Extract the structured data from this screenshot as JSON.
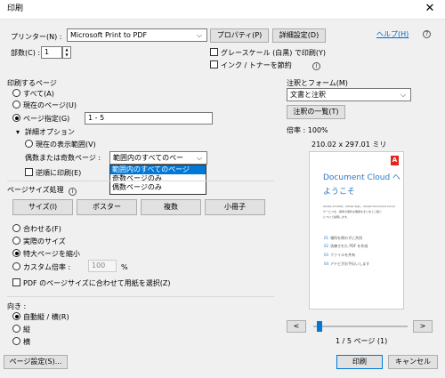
{
  "window": {
    "title": "印刷",
    "close_glyph": "✕"
  },
  "printer": {
    "label": "プリンター(N) :",
    "selected": "Microsoft Print to PDF",
    "properties_button": "プロパティ(P)",
    "advanced_button": "詳細設定(D)",
    "help_link": "ヘルプ(H)",
    "copies_label": "部数(C) :",
    "copies_value": "1",
    "grayscale_label": "グレースケール (白黒) で印刷(Y)",
    "save_ink_label": "インク / トナーを節約"
  },
  "pages_to_print": {
    "heading": "印刷するページ",
    "options": [
      "すべて(A)",
      "現在のページ(U)",
      "ページ指定(G)"
    ],
    "selected_index": 2,
    "range_value": "1 - 5",
    "more_options_label": "詳細オプション",
    "current_view_label": "現在の表示範囲(V)",
    "odd_even_label": "偶数または奇数ページ :",
    "odd_even_selected": "範囲内のすべてのペー",
    "odd_even_options": [
      "範囲内のすべてのページ",
      "奇数ページのみ",
      "偶数ページのみ"
    ],
    "reverse_label": "逆順に印刷(E)"
  },
  "page_sizing": {
    "heading": "ページサイズ処理",
    "buttons": [
      "サイズ(I)",
      "ポスター",
      "複数",
      "小冊子"
    ],
    "options": [
      "合わせる(F)",
      "実際のサイズ",
      "特大ページを縮小",
      "カスタム倍率 :"
    ],
    "selected_index": 2,
    "scale_value": "100",
    "scale_unit": "%",
    "pdf_paper_label": "PDF のページサイズに合わせて用紙を選択(Z)"
  },
  "orientation": {
    "heading": "向き :",
    "options": [
      "自動縦 / 横(R)",
      "縦",
      "横"
    ],
    "selected_index": 0
  },
  "comments_forms": {
    "heading": "注釈とフォーム(M)",
    "selected": "文書と注釈",
    "summary_button": "注釈の一覧(T)"
  },
  "preview": {
    "scale_label": "倍率 : 100%",
    "paper_size": "210.02 x 297.01 ミリ",
    "doc_title_line1": "Document Cloud へ",
    "doc_title_line2": "ようこそ",
    "doc_body_line1": "Adobe Acrobat、Adobe Sign、Adobe Document Cloud",
    "doc_body_line2": "サービスを、標準の便利な機能をまとめてご紹介",
    "doc_body_line3": "について説明します。",
    "bullets": [
      {
        "num": "01",
        "text": "場所を問わずに共同"
      },
      {
        "num": "02",
        "text": "洗練された PDF を作成"
      },
      {
        "num": "03",
        "text": "ファイルを共有"
      },
      {
        "num": "04",
        "text": "アドビがお手伝いします"
      }
    ],
    "adobe_logo_text": "A",
    "prev_glyph": "<",
    "next_glyph": ">",
    "page_indicator": "1 / 5 ページ (1)",
    "slider_fraction": 0.0
  },
  "footer": {
    "page_setup_button": "ページ設定(S)...",
    "print_button": "印刷",
    "cancel_button": "キャンセル"
  },
  "glyphs": {
    "caret_down": "⌵",
    "spin_up": "▲",
    "spin_down": "▼",
    "info": "i",
    "expand": "▾"
  },
  "colors": {
    "accent": "#0078d7",
    "adobe_red": "#e3261c",
    "doc_blue": "#2b78c5"
  }
}
